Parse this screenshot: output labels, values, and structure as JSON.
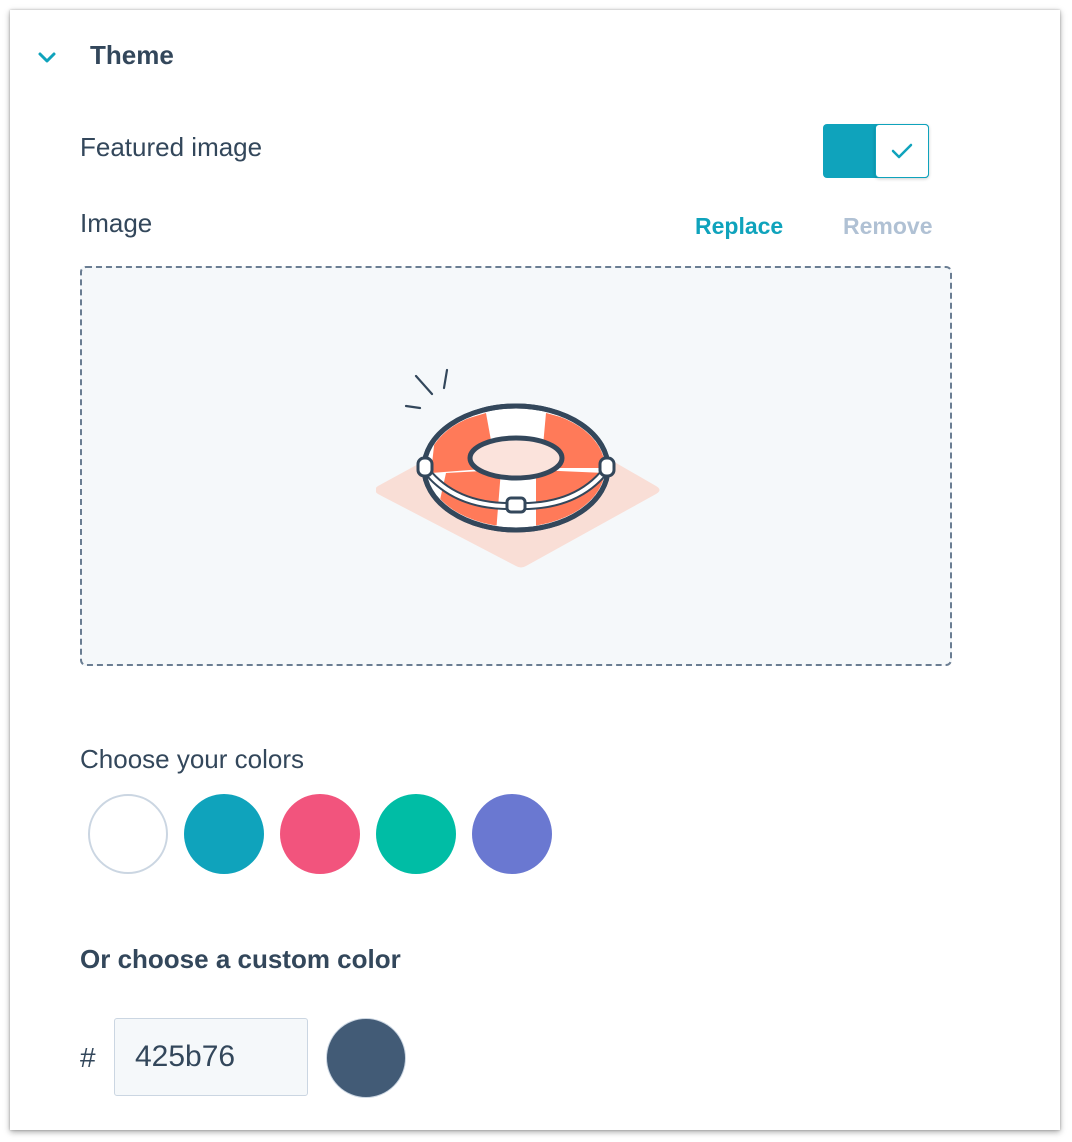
{
  "section": {
    "title": "Theme",
    "icon": "chevron-down-icon"
  },
  "featured_image": {
    "label": "Featured image",
    "enabled": true
  },
  "image": {
    "label": "Image",
    "replace_label": "Replace",
    "remove_label": "Remove"
  },
  "colors": {
    "label": "Choose your colors",
    "swatches": [
      "#ffffff",
      "#0fa3bc",
      "#f2547d",
      "#00bda5",
      "#6a78d1"
    ]
  },
  "custom_color": {
    "label": "Or choose a custom color",
    "hash": "#",
    "value": "425b76",
    "preview": "#425b76"
  },
  "theme_colors": {
    "accent": "#0fa3bc",
    "text": "#33475b",
    "muted": "#b0c1d4"
  }
}
